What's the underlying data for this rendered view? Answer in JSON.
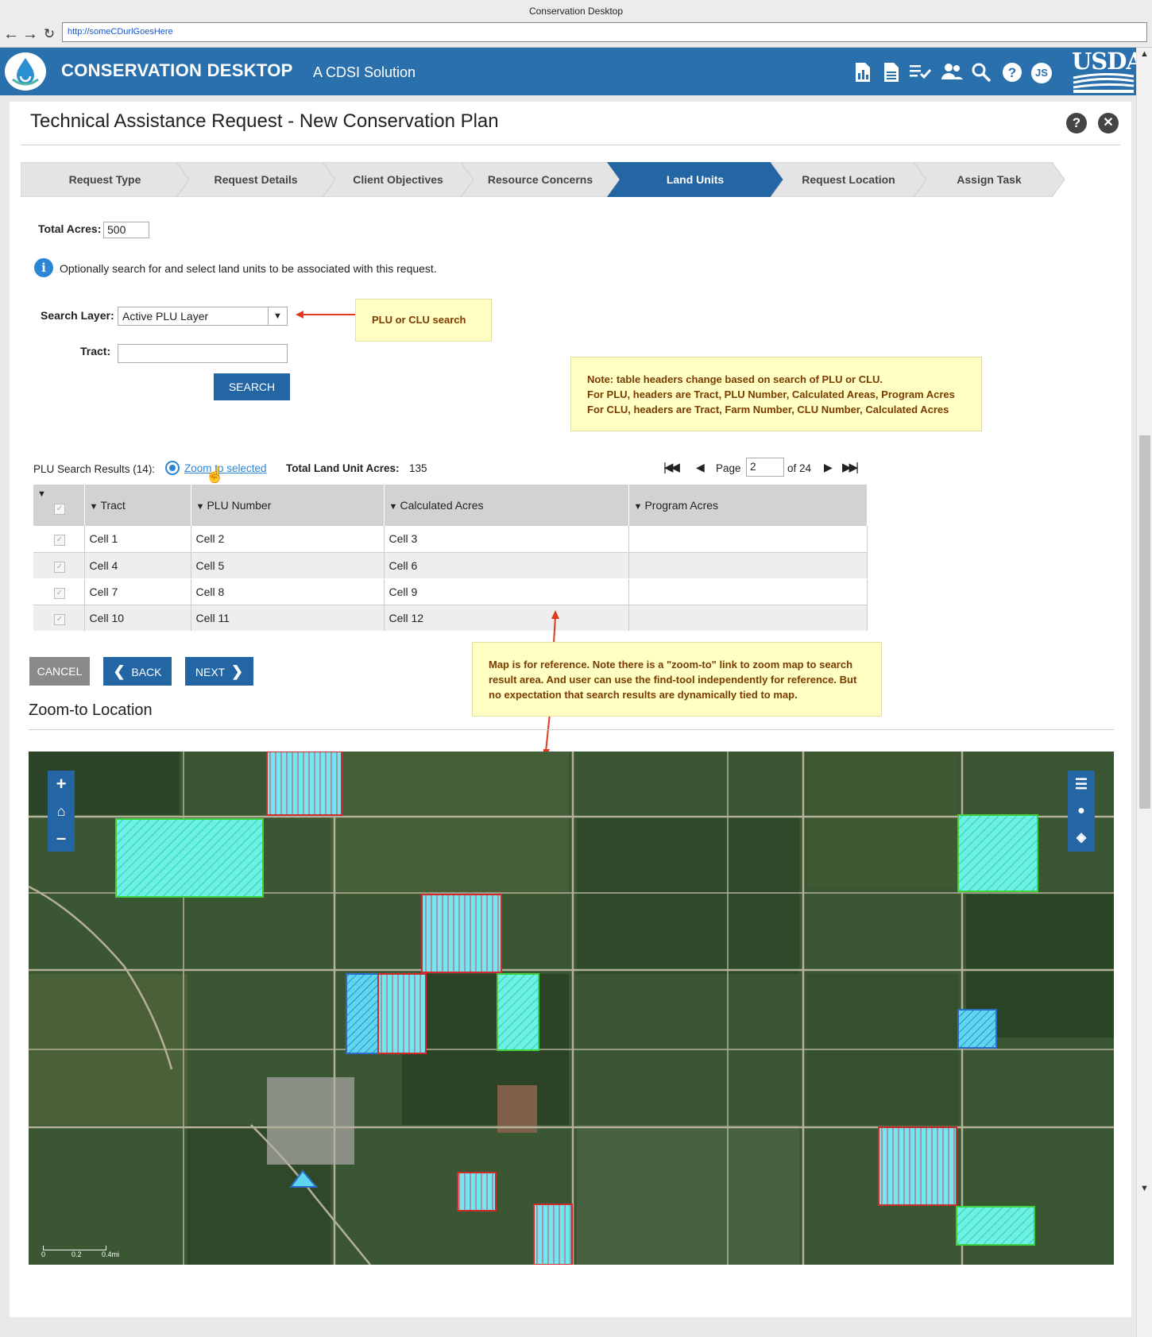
{
  "browser": {
    "window_title": "Conservation Desktop",
    "url": "http://someCDurlGoesHere"
  },
  "header": {
    "app_title": "CONSERVATION DESKTOP",
    "app_subtitle": "A CDSI Solution",
    "icons": [
      "report-icon",
      "document-icon",
      "checklist-icon",
      "people-icon",
      "search-icon",
      "help-icon",
      "user-avatar"
    ],
    "user_initials": "JS",
    "brand_logo": "USDA",
    "brand_color": "#2970ad"
  },
  "page": {
    "title": "Technical Assistance Request - New Conservation Plan"
  },
  "wizard": {
    "steps": [
      "Request Type",
      "Request Details",
      "Client Objectives",
      "Resource Concerns",
      "Land Units",
      "Request Location",
      "Assign Task"
    ],
    "active_index": 4,
    "active_color": "#2466a3"
  },
  "form": {
    "total_acres_label": "Total Acres:",
    "total_acres_value": "500",
    "info_text": "Optionally search for and select land units to be associated with this request.",
    "search_layer_label": "Search Layer:",
    "search_layer_value": "Active PLU Layer",
    "tract_label": "Tract:",
    "tract_value": "",
    "search_button": "SEARCH"
  },
  "notes": {
    "plu_clu": "PLU or CLU search",
    "headers_note": [
      "Note: table headers change based on search of PLU or CLU.",
      "For PLU, headers are Tract, PLU Number, Calculated Areas, Program Acres",
      "For CLU,  headers are Tract, Farm Number, CLU Number, Calculated Acres"
    ],
    "map_note": [
      "Map is for reference. Note there is a \"zoom-to\" link to zoom map to search",
      "result area. And user can use the find-tool independently for reference. But",
      "no expectation that search results are dynamically tied to map."
    ]
  },
  "results": {
    "label": "PLU Search Results (14):",
    "zoom_link": "Zoom to selected",
    "total_label": "Total Land Unit Acres:",
    "total_value": "135",
    "pager": {
      "page_label": "Page",
      "page_value": "2",
      "of_label": "of 24"
    },
    "columns": [
      "Tract",
      "PLU Number",
      "Calculated Acres",
      "Program Acres"
    ],
    "rows": [
      [
        "Cell 1",
        "Cell 2",
        "Cell 3",
        ""
      ],
      [
        "Cell 4",
        "Cell 5",
        "Cell 6",
        ""
      ],
      [
        "Cell 7",
        "Cell 8",
        "Cell 9",
        ""
      ],
      [
        "Cell 10",
        "Cell 11",
        "Cell 12",
        ""
      ]
    ]
  },
  "actions": {
    "cancel": "CANCEL",
    "back": "BACK",
    "next": "NEXT"
  },
  "map": {
    "section_title": "Zoom-to Location",
    "scale_labels": [
      "0",
      "0.2",
      "0.4mi"
    ],
    "tools": [
      "zoom-in-icon",
      "home-icon",
      "zoom-out-icon",
      "layers-list-icon",
      "basemap-icon",
      "find-tool-icon"
    ]
  }
}
